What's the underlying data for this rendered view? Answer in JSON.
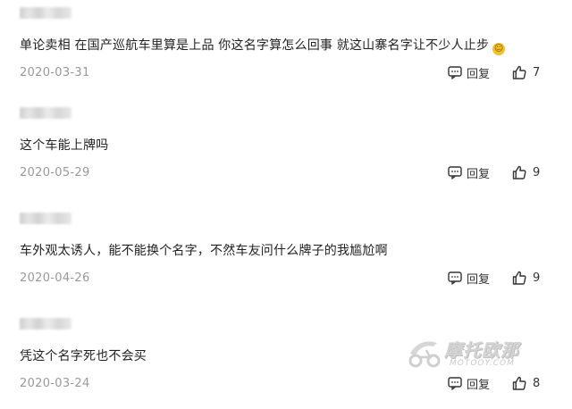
{
  "comments": [
    {
      "user_blurred": true,
      "text": "单论卖相 在国产巡航车里算是上品 你这名字算怎么回事 就这山寨名字让不少人止步",
      "has_emoji": true,
      "date": "2020-03-31",
      "reply_label": "回复",
      "likes": "7"
    },
    {
      "user_blurred": true,
      "text": "这个车能上牌吗",
      "has_emoji": false,
      "date": "2020-05-29",
      "reply_label": "回复",
      "likes": "9"
    },
    {
      "user_blurred": true,
      "text": "车外观太诱人，能不能换个名字，不然车友问什么牌子的我尴尬啊",
      "has_emoji": false,
      "date": "2020-04-26",
      "reply_label": "回复",
      "likes": "9"
    },
    {
      "user_blurred": true,
      "text": "凭这个名字死也不会买",
      "has_emoji": false,
      "date": "2020-03-24",
      "reply_label": "回复",
      "likes": "8"
    }
  ],
  "icons": {
    "reply": "comment-bubble-icon",
    "like": "thumbs-up-icon",
    "emoji": "smile-emoji-icon"
  },
  "watermark": {
    "main": "摩托欧那",
    "sub": "MOTOOY.COM"
  },
  "colors": {
    "text": "#222222",
    "date": "#999999",
    "icon": "#333333"
  }
}
